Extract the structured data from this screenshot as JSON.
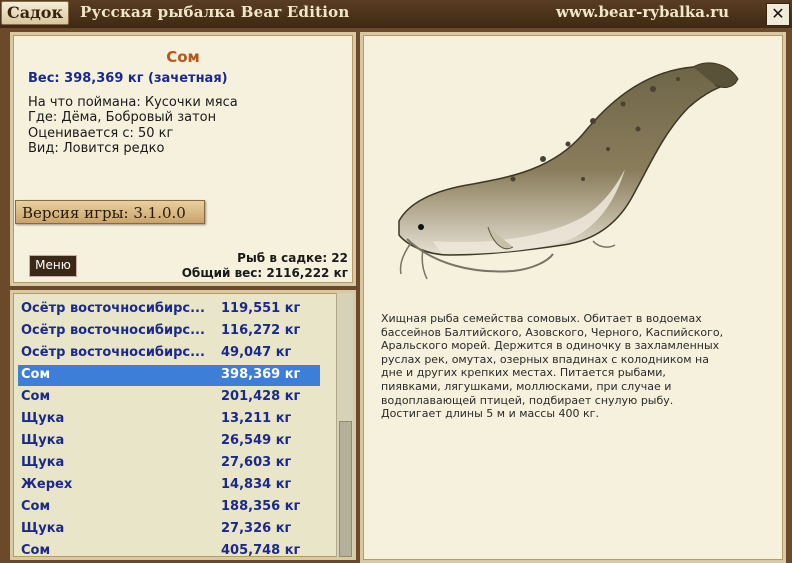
{
  "window": {
    "tab_label": "Садок",
    "app_title": "Русская рыбалка Bear Edition",
    "site_url": "www.bear-rybalka.ru",
    "close_glyph": "✕"
  },
  "fish": {
    "name": "Сом",
    "weight_line": "Вес: 398,369 кг (зачетная)",
    "bait_line": "На что поймана: Кусочки мяса",
    "place_line": "Где: Дёма, Бобровый затон",
    "value_line": "Оценивается с: 50 кг",
    "rarity_line": "Вид: Ловится редко"
  },
  "game": {
    "version": "Версия игры: 3.1.0.0",
    "menu_label": "Меню"
  },
  "stats": {
    "count_line": "Рыб в садке: 22",
    "total_line": "Общий вес: 2116,222 кг"
  },
  "catch_list": [
    {
      "name": "Осётр восточносибирс...",
      "weight": "119,551 кг"
    },
    {
      "name": "Осётр восточносибирс...",
      "weight": "116,272 кг"
    },
    {
      "name": "Осётр восточносибирс...",
      "weight": "49,047 кг"
    },
    {
      "name": "Сом",
      "weight": "398,369 кг",
      "selected": true
    },
    {
      "name": "Сом",
      "weight": "201,428 кг"
    },
    {
      "name": "Щука",
      "weight": "13,211 кг"
    },
    {
      "name": "Щука",
      "weight": "26,549 кг"
    },
    {
      "name": "Щука",
      "weight": "27,603 кг"
    },
    {
      "name": "Жерех",
      "weight": "14,834 кг"
    },
    {
      "name": "Сом",
      "weight": "188,356 кг"
    },
    {
      "name": "Щука",
      "weight": "27,326 кг"
    },
    {
      "name": "Сом",
      "weight": "405,748 кг"
    }
  ],
  "description": [
    "Хищная рыба семейства сомовых. Обитает в водоемах",
    "бассейнов Балтийского, Азовского, Черного, Каспийского,",
    "Аральского морей. Держится в одиночку в захламленных",
    "руслах рек, омутах, озерных впадинах с колодником на",
    "дне и других крепких местах. Питается рыбами,",
    "пиявками, лягушками, моллюсками, при случае и",
    "водоплавающей птицей, подбирает снулую рыбу.",
    "Достигает длины 5 м и массы 400 кг."
  ],
  "colors": {
    "selected_row": "#3d7fd8",
    "list_text": "#1b2a8a",
    "fish_name": "#b5561a"
  }
}
